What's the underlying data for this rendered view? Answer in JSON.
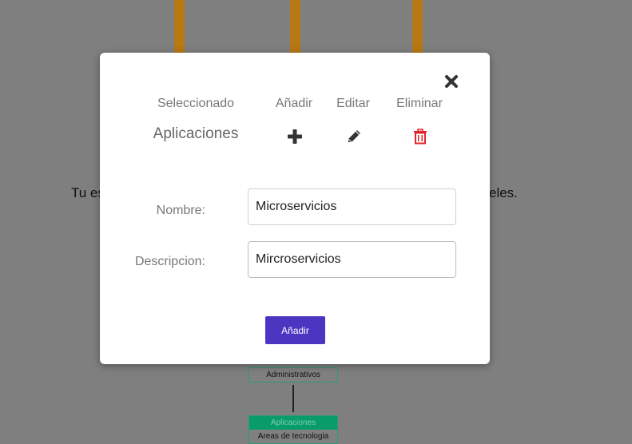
{
  "background": {
    "text_left": "Tu es",
    "text_right": "eles.",
    "nodes": [
      {
        "header": "",
        "label": "Administrativos"
      },
      {
        "header": "Aplicaciones",
        "label": "Areas de tecnologia"
      }
    ]
  },
  "modal": {
    "columns": {
      "selected": "Seleccionado",
      "add": "Añadir",
      "edit": "Editar",
      "delete": "Eliminar"
    },
    "selected_value": "Aplicaciones",
    "form": {
      "name_label": "Nombre:",
      "name_value": "Microservicios",
      "description_label": "Descripcion:",
      "description_value": "Mircroservicios"
    },
    "submit_label": "Añadir",
    "icons": {
      "close": "close-icon",
      "add": "plus-icon",
      "edit": "pencil-icon",
      "delete": "trash-icon"
    },
    "colors": {
      "accent": "#4b35c1",
      "danger": "#e2252b",
      "icon": "#333333"
    }
  }
}
